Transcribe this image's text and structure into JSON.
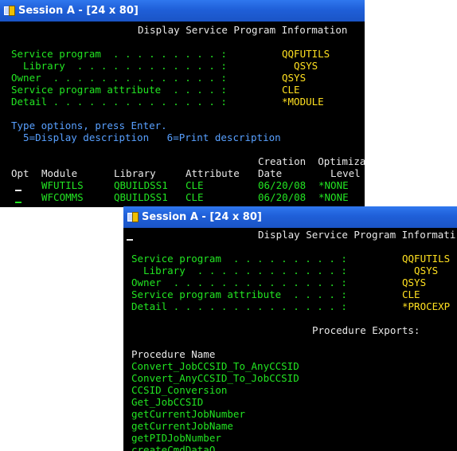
{
  "window1": {
    "title": "Session A - [24 x 80]",
    "screen_title": "Display Service Program Information",
    "fields": [
      {
        "label": "Service program  . . . . . . . . . :",
        "value": "QQFUTILS"
      },
      {
        "label": "  Library  . . . . . . . . . . . . :",
        "value": "  QSYS"
      },
      {
        "label": "Owner  . . . . . . . . . . . . . . :",
        "value": "QSYS"
      },
      {
        "label": "Service program attribute  . . . . :",
        "value": "CLE"
      },
      {
        "label": "Detail . . . . . . . . . . . . . . :",
        "value": "*MODULE"
      }
    ],
    "instructions": "Type options, press Enter.",
    "options": "  5=Display description   6=Print description",
    "col_header_top": "Creation  Optimiza",
    "col_header_opt": "Opt",
    "col_header_module": "Module",
    "col_header_library": "Library",
    "col_header_attribute": "Attribute",
    "col_header_date": "Date",
    "col_header_level": "  Level",
    "rows": [
      {
        "module": "WFUTILS",
        "library": "QBUILDSS1",
        "attribute": "CLE",
        "date": "06/20/08",
        "level": "*NONE"
      },
      {
        "module": "WFCOMMS",
        "library": "QBUILDSS1",
        "attribute": "CLE",
        "date": "06/20/08",
        "level": "*NONE"
      }
    ]
  },
  "window2": {
    "title": "Session A - [24 x 80]",
    "screen_title": "Display Service Program Informati",
    "fields": [
      {
        "label": "Service program  . . . . . . . . . :",
        "value": "QQFUTILS"
      },
      {
        "label": "  Library  . . . . . . . . . . . . :",
        "value": "  QSYS"
      },
      {
        "label": "Owner  . . . . . . . . . . . . . . :",
        "value": "QSYS"
      },
      {
        "label": "Service program attribute  . . . . :",
        "value": "CLE"
      },
      {
        "label": "Detail . . . . . . . . . . . . . . :",
        "value": "*PROCEXP"
      }
    ],
    "section_heading": "Procedure Exports:",
    "list_header": "Procedure Name",
    "procedures": [
      "Convert_JobCCSID_To_AnyCCSID",
      "Convert_AnyCCSID_To_JobCCSID",
      "CCSID_Conversion",
      "Get_JobCCSID",
      "getCurrentJobNumber",
      "getCurrentJobName",
      "getPIDJobNumber",
      "createCmdDataQ"
    ]
  },
  "colors": {
    "titlebar": "#1f5fd8",
    "screen_bg": "#000000",
    "green": "#22e422",
    "white": "#e8e8e8",
    "blue": "#58a0ff",
    "yellow": "#ffe020"
  }
}
